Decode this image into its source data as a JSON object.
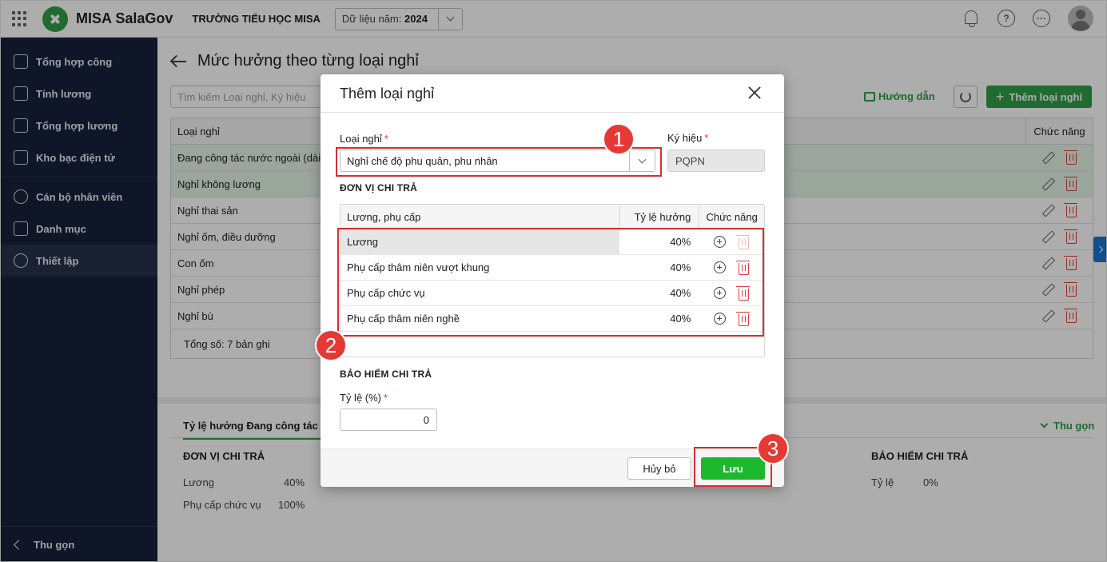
{
  "app": {
    "brand": "MISA SalaGov",
    "school": "TRƯỜNG TIỂU HỌC MISA",
    "year_label": "Dữ liệu năm:",
    "year_value": "2024"
  },
  "sidebar": {
    "items": [
      {
        "label": "Tổng hợp công",
        "icon": "calendar-icon"
      },
      {
        "label": "Tính lương",
        "icon": "money-icon"
      },
      {
        "label": "Tổng hợp lương",
        "icon": "salary-report-icon"
      },
      {
        "label": "Kho bạc điện tử",
        "icon": "treasury-icon"
      },
      {
        "label": "Cán bộ nhân viên",
        "icon": "staff-icon"
      },
      {
        "label": "Danh mục",
        "icon": "catalog-icon"
      },
      {
        "label": "Thiết lập",
        "icon": "settings-icon"
      }
    ],
    "collapse_label": "Thu gọn"
  },
  "page": {
    "title": "Mức hưởng theo từng loại nghỉ",
    "search_placeholder": "Tìm kiếm Loại nghỉ, Ký hiệu",
    "guide_label": "Hướng dẫn",
    "add_label": "Thêm loại nghỉ",
    "table": {
      "col_type": "Loại nghỉ",
      "col_actions": "Chức năng",
      "rows": [
        "Đang công tác nước ngoài (dài",
        "Nghỉ không lương",
        "Nghỉ thai sản",
        "Nghỉ ốm, điều dưỡng",
        "Con ốm",
        "Nghỉ phép",
        "Nghỉ bù"
      ],
      "total": "Tổng số: 7 bản ghi"
    },
    "lower": {
      "tab": "Tỷ lệ hưởng Đang công tác nước ngoài",
      "collapse": "Thu gọn",
      "pay_section": "ĐƠN VỊ CHI TRẢ",
      "ins_section": "BẢO HIỂM CHI TRẢ",
      "pay_rows": [
        {
          "name": "Lương",
          "value": "40%"
        },
        {
          "name": "Phụ cấp chức vụ",
          "value": "100%"
        }
      ],
      "ins_rate_label": "Tỷ lệ",
      "ins_rate_value": "0%"
    }
  },
  "modal": {
    "title": "Thêm loại nghỉ",
    "type_label": "Loại nghỉ",
    "type_value": "Nghỉ chế độ phu quân, phu nhân",
    "code_label": "Ký hiệu",
    "code_value": "PQPN",
    "pay_section": "ĐƠN VỊ CHI TRẢ",
    "pay_table": {
      "col_name": "Lương, phụ cấp",
      "col_rate": "Tỷ lệ hưởng",
      "col_actions": "Chức năng",
      "rows": [
        {
          "name": "Lương",
          "rate": "40%"
        },
        {
          "name": "Phụ cấp thâm niên vượt khung",
          "rate": "40%"
        },
        {
          "name": "Phụ cấp chức vụ",
          "rate": "40%"
        },
        {
          "name": "Phụ cấp thâm niên nghề",
          "rate": "40%"
        }
      ]
    },
    "ins_section": "BẢO HIỂM CHI TRẢ",
    "rate_label": "Tỷ lệ (%)",
    "rate_value": "0",
    "cancel_label": "Hủy bỏ",
    "save_label": "Lưu"
  },
  "annotations": {
    "step1": "1",
    "step2": "2",
    "step3": "3",
    "color": "#d32f2f"
  },
  "colors": {
    "accent": "#2e9e47",
    "sidebar": "#17213a",
    "save": "#1db82e",
    "danger": "#e53935"
  }
}
